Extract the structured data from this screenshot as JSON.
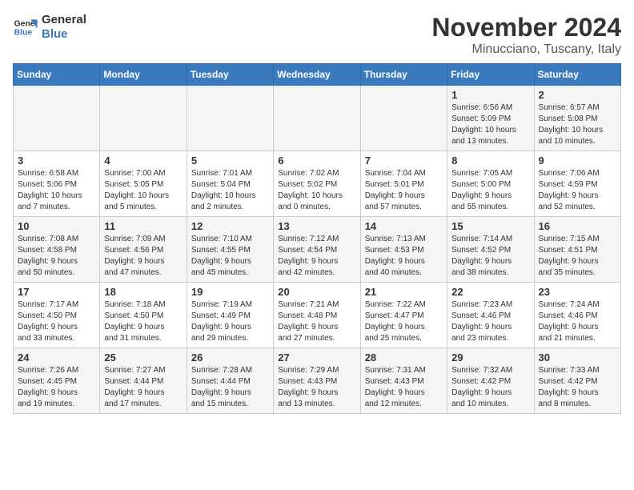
{
  "logo": {
    "line1": "General",
    "line2": "Blue"
  },
  "header": {
    "month": "November 2024",
    "location": "Minucciano, Tuscany, Italy"
  },
  "weekdays": [
    "Sunday",
    "Monday",
    "Tuesday",
    "Wednesday",
    "Thursday",
    "Friday",
    "Saturday"
  ],
  "weeks": [
    [
      {
        "day": "",
        "info": ""
      },
      {
        "day": "",
        "info": ""
      },
      {
        "day": "",
        "info": ""
      },
      {
        "day": "",
        "info": ""
      },
      {
        "day": "",
        "info": ""
      },
      {
        "day": "1",
        "info": "Sunrise: 6:56 AM\nSunset: 5:09 PM\nDaylight: 10 hours\nand 13 minutes."
      },
      {
        "day": "2",
        "info": "Sunrise: 6:57 AM\nSunset: 5:08 PM\nDaylight: 10 hours\nand 10 minutes."
      }
    ],
    [
      {
        "day": "3",
        "info": "Sunrise: 6:58 AM\nSunset: 5:06 PM\nDaylight: 10 hours\nand 7 minutes."
      },
      {
        "day": "4",
        "info": "Sunrise: 7:00 AM\nSunset: 5:05 PM\nDaylight: 10 hours\nand 5 minutes."
      },
      {
        "day": "5",
        "info": "Sunrise: 7:01 AM\nSunset: 5:04 PM\nDaylight: 10 hours\nand 2 minutes."
      },
      {
        "day": "6",
        "info": "Sunrise: 7:02 AM\nSunset: 5:02 PM\nDaylight: 10 hours\nand 0 minutes."
      },
      {
        "day": "7",
        "info": "Sunrise: 7:04 AM\nSunset: 5:01 PM\nDaylight: 9 hours\nand 57 minutes."
      },
      {
        "day": "8",
        "info": "Sunrise: 7:05 AM\nSunset: 5:00 PM\nDaylight: 9 hours\nand 55 minutes."
      },
      {
        "day": "9",
        "info": "Sunrise: 7:06 AM\nSunset: 4:59 PM\nDaylight: 9 hours\nand 52 minutes."
      }
    ],
    [
      {
        "day": "10",
        "info": "Sunrise: 7:08 AM\nSunset: 4:58 PM\nDaylight: 9 hours\nand 50 minutes."
      },
      {
        "day": "11",
        "info": "Sunrise: 7:09 AM\nSunset: 4:56 PM\nDaylight: 9 hours\nand 47 minutes."
      },
      {
        "day": "12",
        "info": "Sunrise: 7:10 AM\nSunset: 4:55 PM\nDaylight: 9 hours\nand 45 minutes."
      },
      {
        "day": "13",
        "info": "Sunrise: 7:12 AM\nSunset: 4:54 PM\nDaylight: 9 hours\nand 42 minutes."
      },
      {
        "day": "14",
        "info": "Sunrise: 7:13 AM\nSunset: 4:53 PM\nDaylight: 9 hours\nand 40 minutes."
      },
      {
        "day": "15",
        "info": "Sunrise: 7:14 AM\nSunset: 4:52 PM\nDaylight: 9 hours\nand 38 minutes."
      },
      {
        "day": "16",
        "info": "Sunrise: 7:15 AM\nSunset: 4:51 PM\nDaylight: 9 hours\nand 35 minutes."
      }
    ],
    [
      {
        "day": "17",
        "info": "Sunrise: 7:17 AM\nSunset: 4:50 PM\nDaylight: 9 hours\nand 33 minutes."
      },
      {
        "day": "18",
        "info": "Sunrise: 7:18 AM\nSunset: 4:50 PM\nDaylight: 9 hours\nand 31 minutes."
      },
      {
        "day": "19",
        "info": "Sunrise: 7:19 AM\nSunset: 4:49 PM\nDaylight: 9 hours\nand 29 minutes."
      },
      {
        "day": "20",
        "info": "Sunrise: 7:21 AM\nSunset: 4:48 PM\nDaylight: 9 hours\nand 27 minutes."
      },
      {
        "day": "21",
        "info": "Sunrise: 7:22 AM\nSunset: 4:47 PM\nDaylight: 9 hours\nand 25 minutes."
      },
      {
        "day": "22",
        "info": "Sunrise: 7:23 AM\nSunset: 4:46 PM\nDaylight: 9 hours\nand 23 minutes."
      },
      {
        "day": "23",
        "info": "Sunrise: 7:24 AM\nSunset: 4:46 PM\nDaylight: 9 hours\nand 21 minutes."
      }
    ],
    [
      {
        "day": "24",
        "info": "Sunrise: 7:26 AM\nSunset: 4:45 PM\nDaylight: 9 hours\nand 19 minutes."
      },
      {
        "day": "25",
        "info": "Sunrise: 7:27 AM\nSunset: 4:44 PM\nDaylight: 9 hours\nand 17 minutes."
      },
      {
        "day": "26",
        "info": "Sunrise: 7:28 AM\nSunset: 4:44 PM\nDaylight: 9 hours\nand 15 minutes."
      },
      {
        "day": "27",
        "info": "Sunrise: 7:29 AM\nSunset: 4:43 PM\nDaylight: 9 hours\nand 13 minutes."
      },
      {
        "day": "28",
        "info": "Sunrise: 7:31 AM\nSunset: 4:43 PM\nDaylight: 9 hours\nand 12 minutes."
      },
      {
        "day": "29",
        "info": "Sunrise: 7:32 AM\nSunset: 4:42 PM\nDaylight: 9 hours\nand 10 minutes."
      },
      {
        "day": "30",
        "info": "Sunrise: 7:33 AM\nSunset: 4:42 PM\nDaylight: 9 hours\nand 8 minutes."
      }
    ]
  ]
}
